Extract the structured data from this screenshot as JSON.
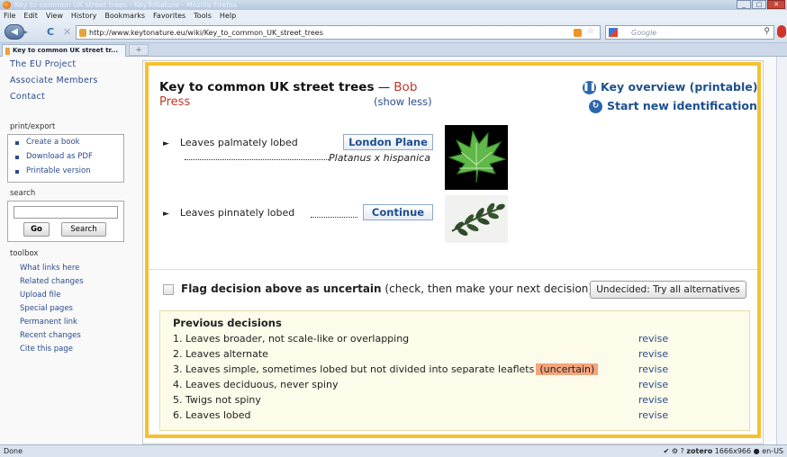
{
  "window": {
    "title": "Key to common UK street trees - KeyToNature - Mozilla Firefox",
    "controls": [
      "_",
      "□",
      "✕"
    ]
  },
  "menubar": [
    "File",
    "Edit",
    "View",
    "History",
    "Bookmarks",
    "Favorites",
    "Tools",
    "Help"
  ],
  "navbar": {
    "url": "http://www.keytonature.eu/wiki/Key_to_common_UK_street_trees",
    "search_placeholder": "Google"
  },
  "tab": {
    "label": "Key to common UK street tr...",
    "new_tab": "+"
  },
  "sidebar": {
    "nav": [
      "The EU Project",
      "Associate Members",
      "Contact"
    ],
    "print_export": {
      "heading": "print/export",
      "items": [
        "Create a book",
        "Download as PDF",
        "Printable version"
      ]
    },
    "search": {
      "heading": "search",
      "go_label": "Go",
      "search_label": "Search"
    },
    "toolbox": {
      "heading": "toolbox",
      "items": [
        "What links here",
        "Related changes",
        "Upload file",
        "Special pages",
        "Permanent link",
        "Recent changes",
        "Cite this page"
      ]
    }
  },
  "key": {
    "title": "Key to common UK street trees",
    "dash": " —",
    "author": "Bob",
    "press": "Press",
    "show_less": "(show less)",
    "overview": "Key overview (printable)",
    "start_new": "Start new identification",
    "leads": [
      {
        "text": "Leaves palmately lobed",
        "button": "London Plane",
        "scientific": "Platanus x hispanica"
      },
      {
        "text": "Leaves pinnately lobed",
        "button": "Continue"
      }
    ],
    "flag": {
      "bold": "Flag decision above as uncertain",
      "rest": "(check, then make your next decision)",
      "checked": false,
      "undecided_button": "Undecided: Try all alternatives"
    },
    "previous": {
      "heading": "Previous decisions",
      "revise_label": "revise",
      "uncertain_label": "(uncertain)",
      "items": [
        "1. Leaves broader, not scale-like or overlapping",
        "2. Leaves alternate",
        "3. Leaves simple, sometimes lobed but not divided into separate leaflets",
        "4. Leaves deciduous, never spiny",
        "5. Twigs not spiny",
        "6. Leaves lobed"
      ]
    }
  },
  "statusbar": {
    "status": "Done",
    "zotero": "zotero",
    "resolution": "1666x966",
    "locale": "en-US"
  }
}
